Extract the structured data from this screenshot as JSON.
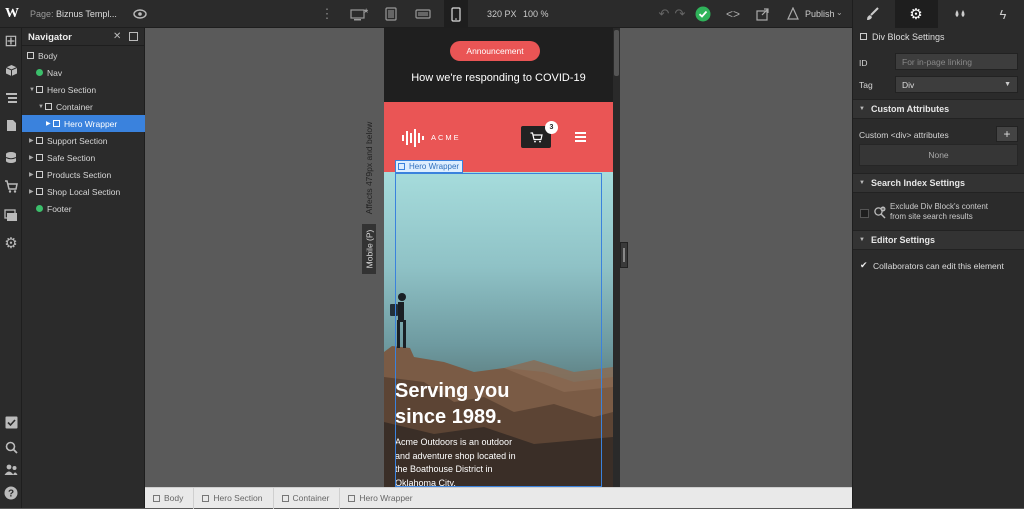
{
  "topbar": {
    "page_label": "Page:",
    "page_name": "Biznus Templ...",
    "width_readout": "320 PX",
    "zoom_readout": "100 %",
    "publish_label": "Publish",
    "tabs": [
      "style",
      "settings",
      "interactions",
      "effects"
    ]
  },
  "navigator": {
    "title": "Navigator",
    "items": [
      {
        "label": "Body",
        "kind": "box"
      },
      {
        "label": "Nav",
        "kind": "symbol"
      },
      {
        "label": "Hero Section",
        "kind": "box"
      },
      {
        "label": "Container",
        "kind": "box"
      },
      {
        "label": "Hero Wrapper",
        "kind": "box",
        "selected": true
      },
      {
        "label": "Support Section",
        "kind": "box"
      },
      {
        "label": "Safe Section",
        "kind": "box"
      },
      {
        "label": "Products Section",
        "kind": "box"
      },
      {
        "label": "Shop Local Section",
        "kind": "box"
      },
      {
        "label": "Footer",
        "kind": "symbol"
      }
    ]
  },
  "canvas": {
    "affects_label": "Affects 479px and below",
    "device_label": "Mobile (P)",
    "selection_tag": "Hero Wrapper"
  },
  "site": {
    "announcement": "Announcement",
    "covid_text": "How we're responding to COVID-19",
    "brand": "ACME",
    "cart_count": "3",
    "hero_title_1": "Serving you",
    "hero_title_2": "since 1989.",
    "hero_body": [
      "Acme Outdoors is an outdoor",
      "and adventure shop located in",
      "the Boathouse District in",
      "Oklahoma City."
    ]
  },
  "breadcrumb": [
    "Body",
    "Hero Section",
    "Container",
    "Hero Wrapper"
  ],
  "panel": {
    "block_settings": "Div Block Settings",
    "id_label": "ID",
    "id_placeholder": "For in-page linking",
    "tag_label": "Tag",
    "tag_value": "Div",
    "custom_attributes": "Custom Attributes",
    "custom_attr_row": "Custom <div> attributes",
    "none_text": "None",
    "search_index": "Search Index Settings",
    "exclude_line1": "Exclude Div Block's content",
    "exclude_line2": "from site search results",
    "editor_settings": "Editor Settings",
    "collaborators": "Collaborators can edit this element"
  },
  "colors": {
    "accent": "#3a82dd",
    "brand_red": "#ea5555",
    "publish_green": "#2fb35a",
    "symbol_green": "#3bbf6b"
  }
}
